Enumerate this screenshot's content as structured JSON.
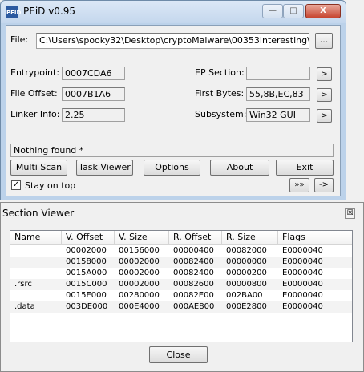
{
  "window": {
    "title": "PEiD v0.95",
    "icon_label": "PEID",
    "minimize_glyph": "—",
    "maximize_glyph": "□",
    "close_glyph": "X"
  },
  "file": {
    "label": "File:",
    "path": "C:\\Users\\spooky32\\Desktop\\cryptoMalware\\00353interesting\\interest",
    "browse_label": "..."
  },
  "fields": {
    "entrypoint_label": "Entrypoint:",
    "entrypoint_value": "0007CDA6",
    "file_offset_label": "File Offset:",
    "file_offset_value": "0007B1A6",
    "linker_label": "Linker Info:",
    "linker_value": "2.25",
    "ep_section_label": "EP Section:",
    "ep_section_value": "",
    "first_bytes_label": "First Bytes:",
    "first_bytes_value": "55,8B,EC,83",
    "subsystem_label": "Subsystem:",
    "subsystem_value": "Win32 GUI",
    "arrow": ">"
  },
  "result": "Nothing found *",
  "buttons": {
    "multi_scan": "Multi Scan",
    "task_viewer": "Task Viewer",
    "options": "Options",
    "about": "About",
    "exit": "Exit",
    "more": "»»",
    "arrow": "->"
  },
  "stay_on_top": {
    "label": "Stay on top",
    "checked": true,
    "check_glyph": "✓"
  },
  "section_viewer": {
    "title": "Section Viewer",
    "close_glyph": "☒",
    "columns": [
      "Name",
      "V. Offset",
      "V. Size",
      "R. Offset",
      "R. Size",
      "Flags"
    ],
    "rows": [
      [
        "",
        "00002000",
        "00156000",
        "00000400",
        "00082000",
        "E0000040"
      ],
      [
        "",
        "00158000",
        "00002000",
        "00082400",
        "00000000",
        "E0000040"
      ],
      [
        "",
        "0015A000",
        "00002000",
        "00082400",
        "00000200",
        "E0000040"
      ],
      [
        ".rsrc",
        "0015C000",
        "00002000",
        "00082600",
        "00000800",
        "E0000040"
      ],
      [
        "",
        "0015E000",
        "00280000",
        "00082E00",
        "002BA00",
        "E0000040"
      ],
      [
        ".data",
        "003DE000",
        "000E4000",
        "000AE800",
        "000E2800",
        "E0000040"
      ]
    ],
    "close_label": "Close"
  }
}
